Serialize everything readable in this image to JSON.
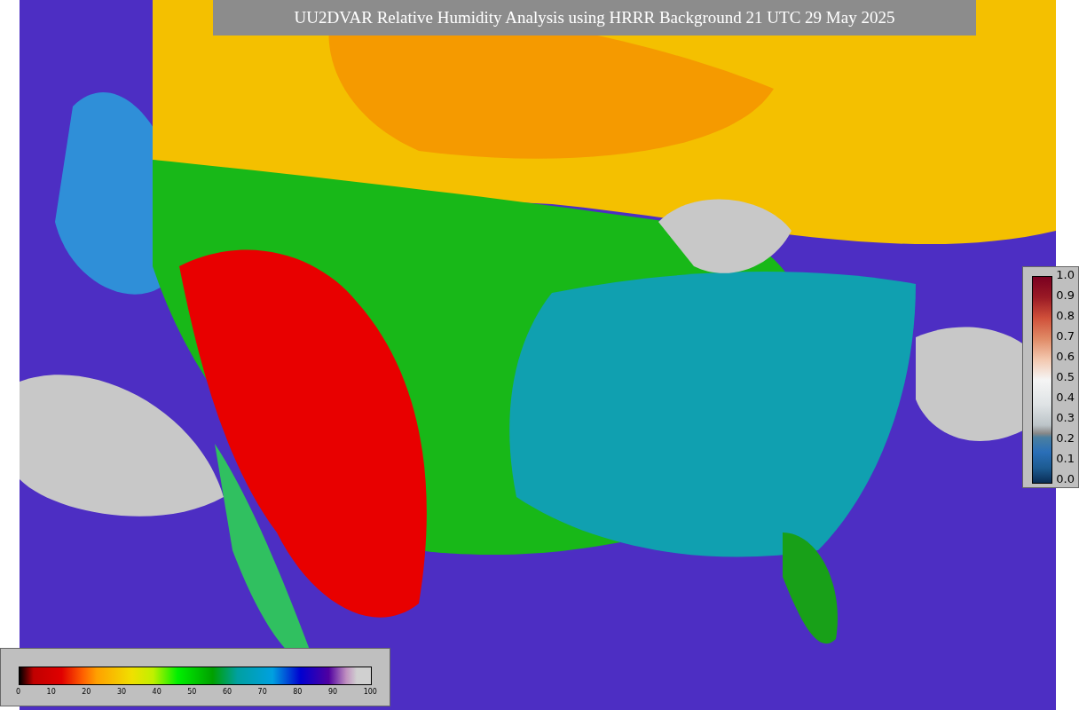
{
  "title": "UU2DVAR Relative Humidity Analysis using HRRR Background 21 UTC 29 May 2025",
  "fraction_scale": {
    "ticks": [
      "1.0",
      "0.9",
      "0.8",
      "0.7",
      "0.6",
      "0.5",
      "0.4",
      "0.3",
      "0.2",
      "0.1",
      "0.0"
    ]
  },
  "humidity_scale": {
    "ticks": [
      "0",
      "10",
      "20",
      "30",
      "40",
      "50",
      "60",
      "70",
      "80",
      "90",
      "100"
    ]
  }
}
